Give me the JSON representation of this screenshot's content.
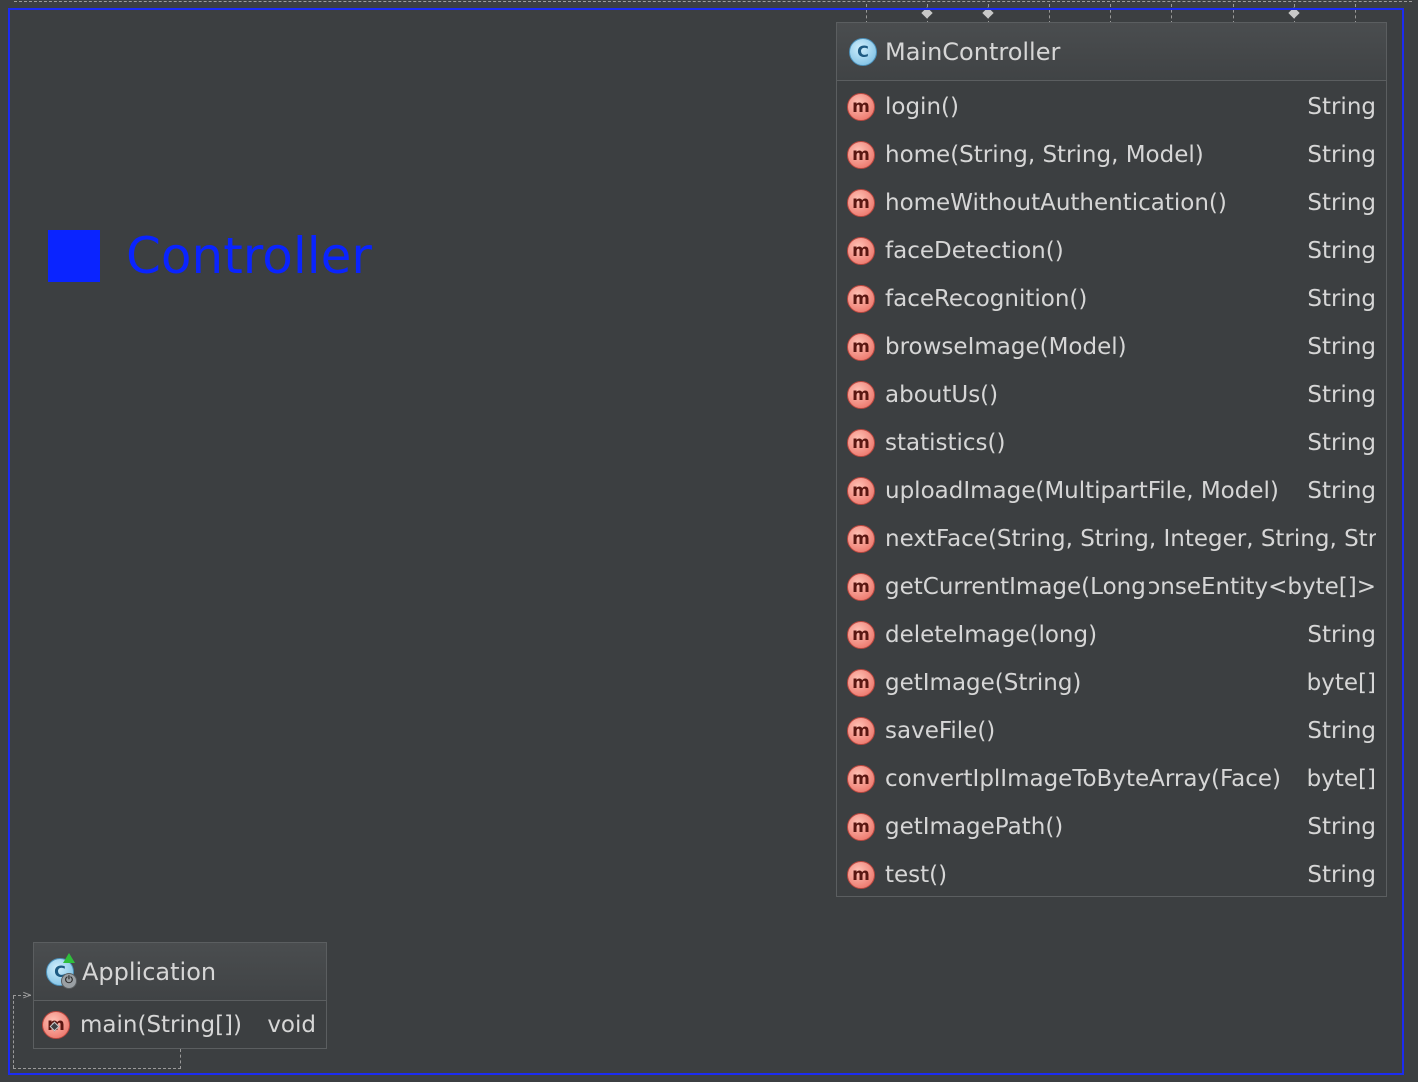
{
  "package": {
    "name": "Controller"
  },
  "classes": {
    "main_controller": {
      "name": "MainController",
      "icon": "class-icon",
      "methods": [
        {
          "name": "login()",
          "type": "String"
        },
        {
          "name": "home(String, String, Model)",
          "type": "String"
        },
        {
          "name": "homeWithoutAuthentication()",
          "type": "String"
        },
        {
          "name": "faceDetection()",
          "type": "String"
        },
        {
          "name": "faceRecognition()",
          "type": "String"
        },
        {
          "name": "browseImage(Model)",
          "type": "String"
        },
        {
          "name": "aboutUs()",
          "type": "String"
        },
        {
          "name": "statistics()",
          "type": "String"
        },
        {
          "name": "uploadImage(MultipartFile, Model)",
          "type": "String"
        },
        {
          "name": "nextFace(String, String, Integer, String, Strin",
          "type": ""
        },
        {
          "name": "getCurrentImage(Long)",
          "type": "ɔnseEntity<byte[]>"
        },
        {
          "name": "deleteImage(long)",
          "type": "String"
        },
        {
          "name": "getImage(String)",
          "type": "byte[]"
        },
        {
          "name": "saveFile()",
          "type": "String"
        },
        {
          "name": "convertIplImageToByteArray(Face)",
          "type": "byte[]"
        },
        {
          "name": "getImagePath()",
          "type": "String"
        },
        {
          "name": "test()",
          "type": "String"
        }
      ]
    },
    "application": {
      "name": "Application",
      "icon": "spring-boot-application-icon",
      "methods": [
        {
          "name": "main(String[])",
          "type": "void"
        }
      ]
    }
  },
  "colors": {
    "background": "#3c3f41",
    "package_accent": "#0a24ff",
    "method_icon": "#e8675c",
    "class_icon": "#6fb8e0"
  }
}
